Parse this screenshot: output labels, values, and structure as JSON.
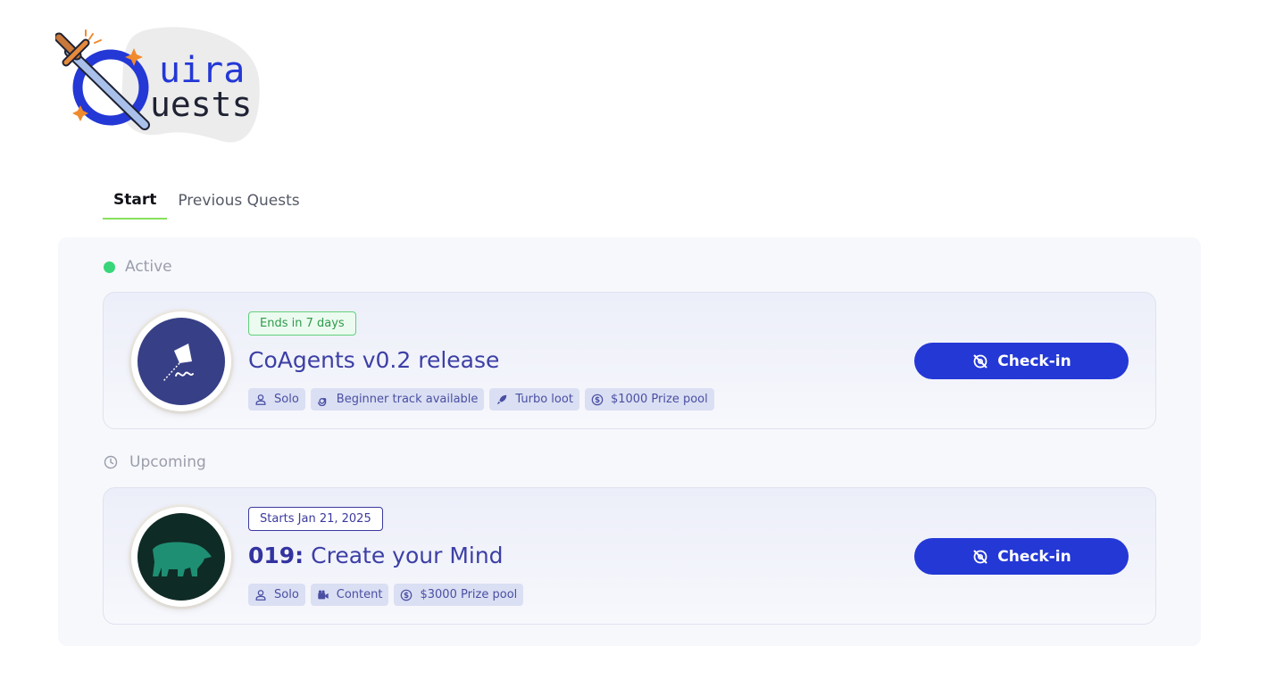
{
  "app": {
    "logo_text_top": "uira",
    "logo_text_bottom": "uests"
  },
  "tabs": [
    {
      "label": "Start",
      "active": true
    },
    {
      "label": "Previous Quests",
      "active": false
    }
  ],
  "sections": {
    "active": {
      "label": "Active",
      "status_color": "#37d67a"
    },
    "upcoming": {
      "label": "Upcoming"
    }
  },
  "quests": [
    {
      "badge": "Ends in 7 days",
      "number": "",
      "title": "CoAgents v0.2 release",
      "tags": [
        {
          "label": "Solo",
          "icon": "user-icon"
        },
        {
          "label": "Beginner track available",
          "icon": "spiral-icon"
        },
        {
          "label": "Turbo loot",
          "icon": "rocket-icon"
        },
        {
          "label": "$1000 Prize pool",
          "icon": "dollar-icon"
        }
      ],
      "button": "Check-in",
      "avatar_color": "#373f86"
    },
    {
      "badge": "Starts Jan 21, 2025",
      "number": "019:",
      "title": "Create your Mind",
      "tags": [
        {
          "label": "Solo",
          "icon": "user-icon"
        },
        {
          "label": "Content",
          "icon": "video-icon"
        },
        {
          "label": "$3000 Prize pool",
          "icon": "dollar-icon"
        }
      ],
      "button": "Check-in",
      "avatar_color": "#0f2b26"
    }
  ],
  "colors": {
    "accent": "#2438d6",
    "tab_underline": "#86e15a"
  }
}
